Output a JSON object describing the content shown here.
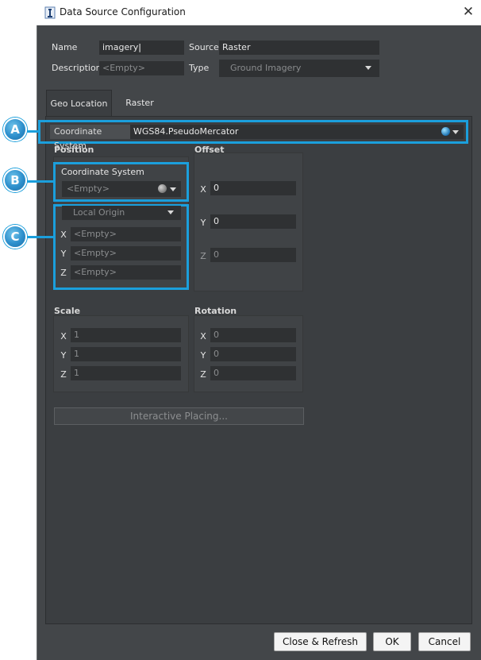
{
  "window": {
    "title": "Data Source Configuration"
  },
  "header": {
    "name_label": "Name",
    "name_value": "imagery",
    "source_label": "Source",
    "source_value": "Raster",
    "description_label": "Description",
    "description_placeholder": "<Empty>",
    "type_label": "Type",
    "type_value": "Ground Imagery"
  },
  "tabs": [
    {
      "label": "Geo Location",
      "active": true
    },
    {
      "label": "Raster",
      "active": false
    }
  ],
  "geo": {
    "cs_label": "Coordinate System",
    "cs_value": "WGS84.PseudoMercator",
    "position": {
      "title": "Position",
      "cs_label": "Coordinate System",
      "cs_value": "<Empty>",
      "origin_value": "Local Origin",
      "x_label": "X",
      "x_value": "<Empty>",
      "y_label": "Y",
      "y_value": "<Empty>",
      "z_label": "Z",
      "z_value": "<Empty>"
    },
    "offset": {
      "title": "Offset",
      "x_label": "X",
      "x_value": "0",
      "y_label": "Y",
      "y_value": "0",
      "z_label": "Z",
      "z_value": "0"
    },
    "scale": {
      "title": "Scale",
      "x_label": "X",
      "x_value": "1",
      "y_label": "Y",
      "y_value": "1",
      "z_label": "Z",
      "z_value": "1"
    },
    "rotation": {
      "title": "Rotation",
      "x_label": "X",
      "x_value": "0",
      "y_label": "Y",
      "y_value": "0",
      "z_label": "Z",
      "z_value": "0"
    },
    "interactive_placing_label": "Interactive Placing..."
  },
  "buttons": {
    "close_refresh": "Close & Refresh",
    "ok": "OK",
    "cancel": "Cancel"
  },
  "callouts": {
    "a": "A",
    "b": "B",
    "c": "C"
  },
  "colors": {
    "accent": "#1b9fdc",
    "background": "#434649",
    "field": "#2f3133"
  },
  "icons": {
    "app": "app-icon",
    "close": "close-icon",
    "globe": "globe-icon",
    "dropdown": "chevron-down-icon"
  }
}
